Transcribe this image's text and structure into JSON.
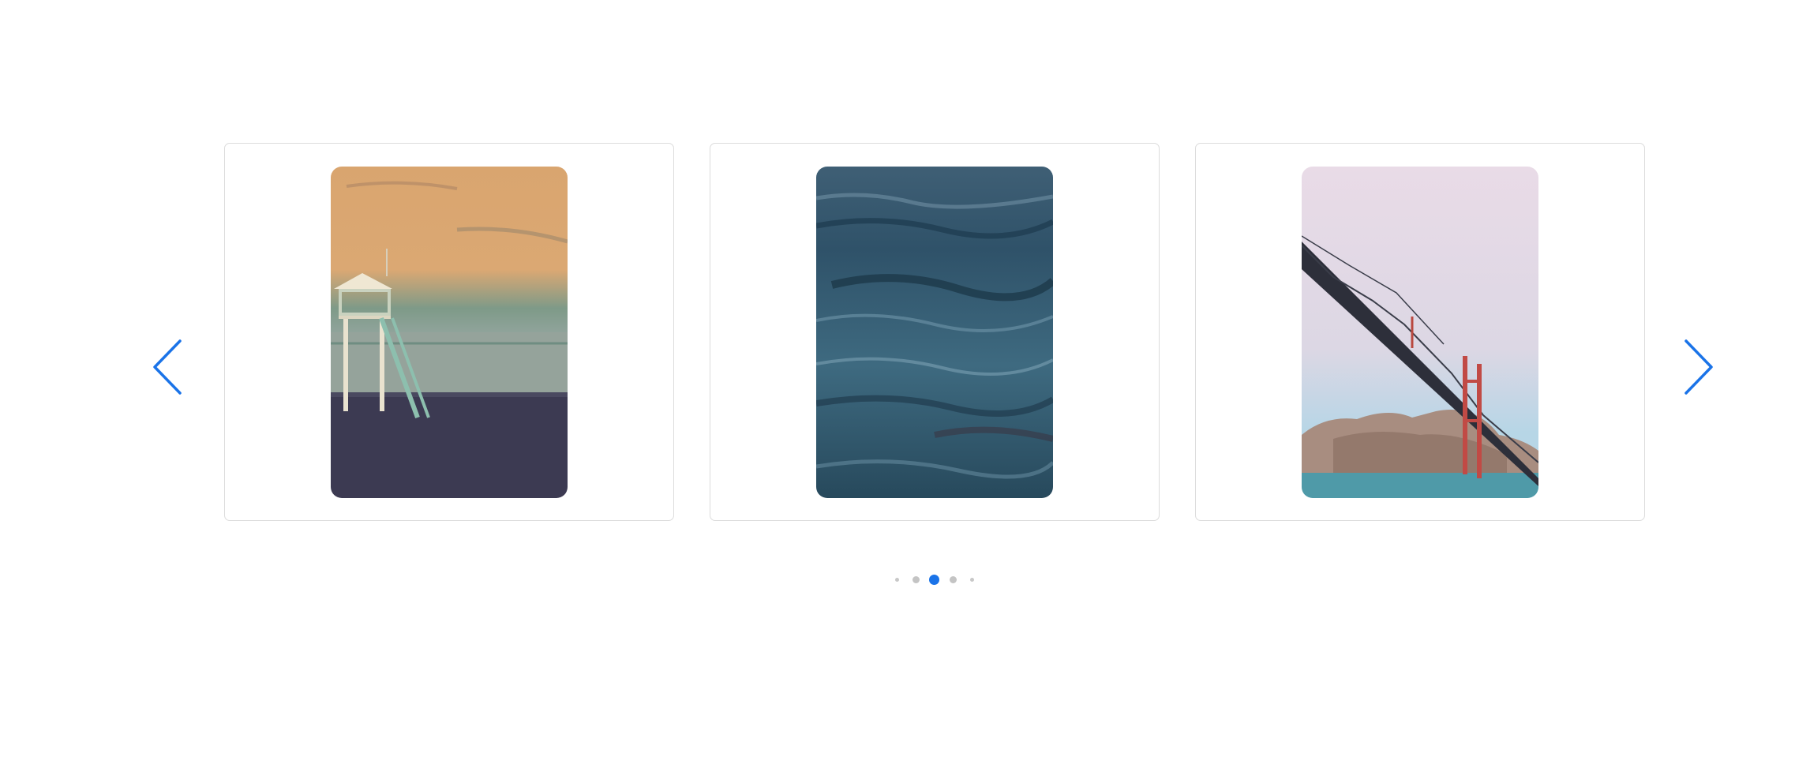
{
  "carousel": {
    "accent_color": "#1a73e8",
    "prev_icon": "chevron-left-icon",
    "next_icon": "chevron-right-icon",
    "slides": [
      {
        "subject": "lifeguard-tower-beach-sunset"
      },
      {
        "subject": "ocean-water-surface"
      },
      {
        "subject": "golden-gate-bridge-fog"
      }
    ],
    "pagination": {
      "total_dots": 5,
      "active_index": 2
    }
  }
}
